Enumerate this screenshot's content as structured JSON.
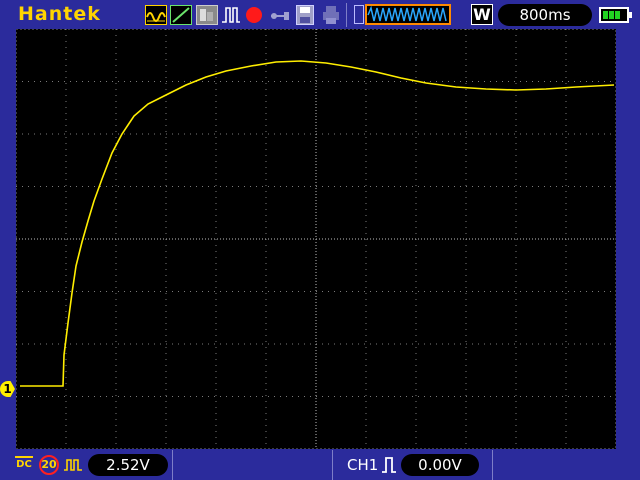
{
  "header": {
    "brand": "Hantek",
    "timebase": "800ms",
    "mode": "W",
    "colors": {
      "brand": "#ffd400",
      "record": "#ff1a1a",
      "timeline_border": "#ff8a00",
      "battery": "#22d122"
    }
  },
  "toolbar": {
    "icons": [
      "waveform-display-icon",
      "vector-mode-icon",
      "persistence-icon",
      "pulse-icon",
      "record-icon",
      "usb-icon",
      "save-icon",
      "print-icon"
    ]
  },
  "screen": {
    "trace_color": "#ffee00",
    "channel_marker": "1"
  },
  "footer": {
    "coupling": "DC",
    "bandwidth_limit": "20",
    "ch_scale": "2.52V",
    "trigger_source": "CH1",
    "trigger_level": "0.00V"
  }
}
